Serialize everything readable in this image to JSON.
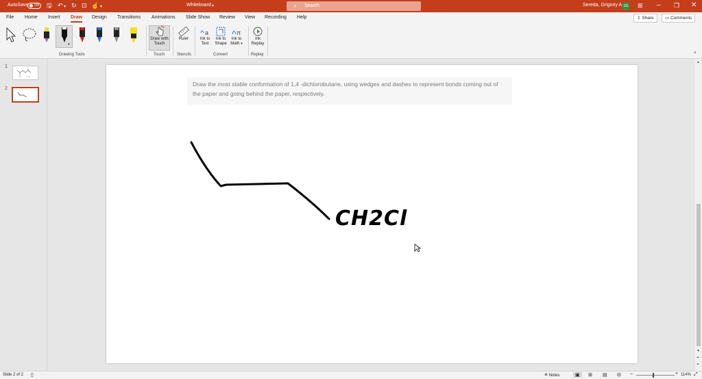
{
  "titlebar": {
    "autosave_label": "AutoSave",
    "autosave_state": "Off",
    "document_title": "Whiteboard",
    "title_caret": "▾",
    "search_placeholder": "Search",
    "user_name": "Sereda, Grigoriy A",
    "user_initials": "SG"
  },
  "menu": {
    "items": [
      "File",
      "Home",
      "Insert",
      "Draw",
      "Design",
      "Transitions",
      "Animations",
      "Slide Show",
      "Review",
      "View",
      "Recording",
      "Help"
    ],
    "share_label": "Share",
    "comments_label": "Comments"
  },
  "ribbon": {
    "drawing_tools_group": "Drawing Tools",
    "draw_with_touch": "Draw with Touch",
    "touch_group": "Touch",
    "ruler": "Ruler",
    "stencils_group": "Stencils",
    "ink_to_text": "Ink to Text",
    "ink_to_shape": "Ink to Shape",
    "ink_to_math": "Ink to Math",
    "convert_group": "Convert",
    "ink_replay": "Ink Replay",
    "replay_group": "Replay",
    "pen_colors": [
      "#e8d84a",
      "#111111",
      "#d81e1e",
      "#2a6fd0",
      "#909090",
      "#f2e21c"
    ]
  },
  "thumbnails": {
    "items": [
      {
        "number": "1",
        "selected": false
      },
      {
        "number": "2",
        "selected": true
      }
    ]
  },
  "slide": {
    "prompt_text": "Draw the most stable conformation of 1,4 -dichlorobutane, using wedges and dashes to represent bonds coming out of the paper and going behind the paper, respectively.",
    "ink_label": "CH2Cl"
  },
  "statusbar": {
    "slide_info": "Slide 2 of 2",
    "notes_label": "Notes",
    "zoom_level": "114%"
  }
}
